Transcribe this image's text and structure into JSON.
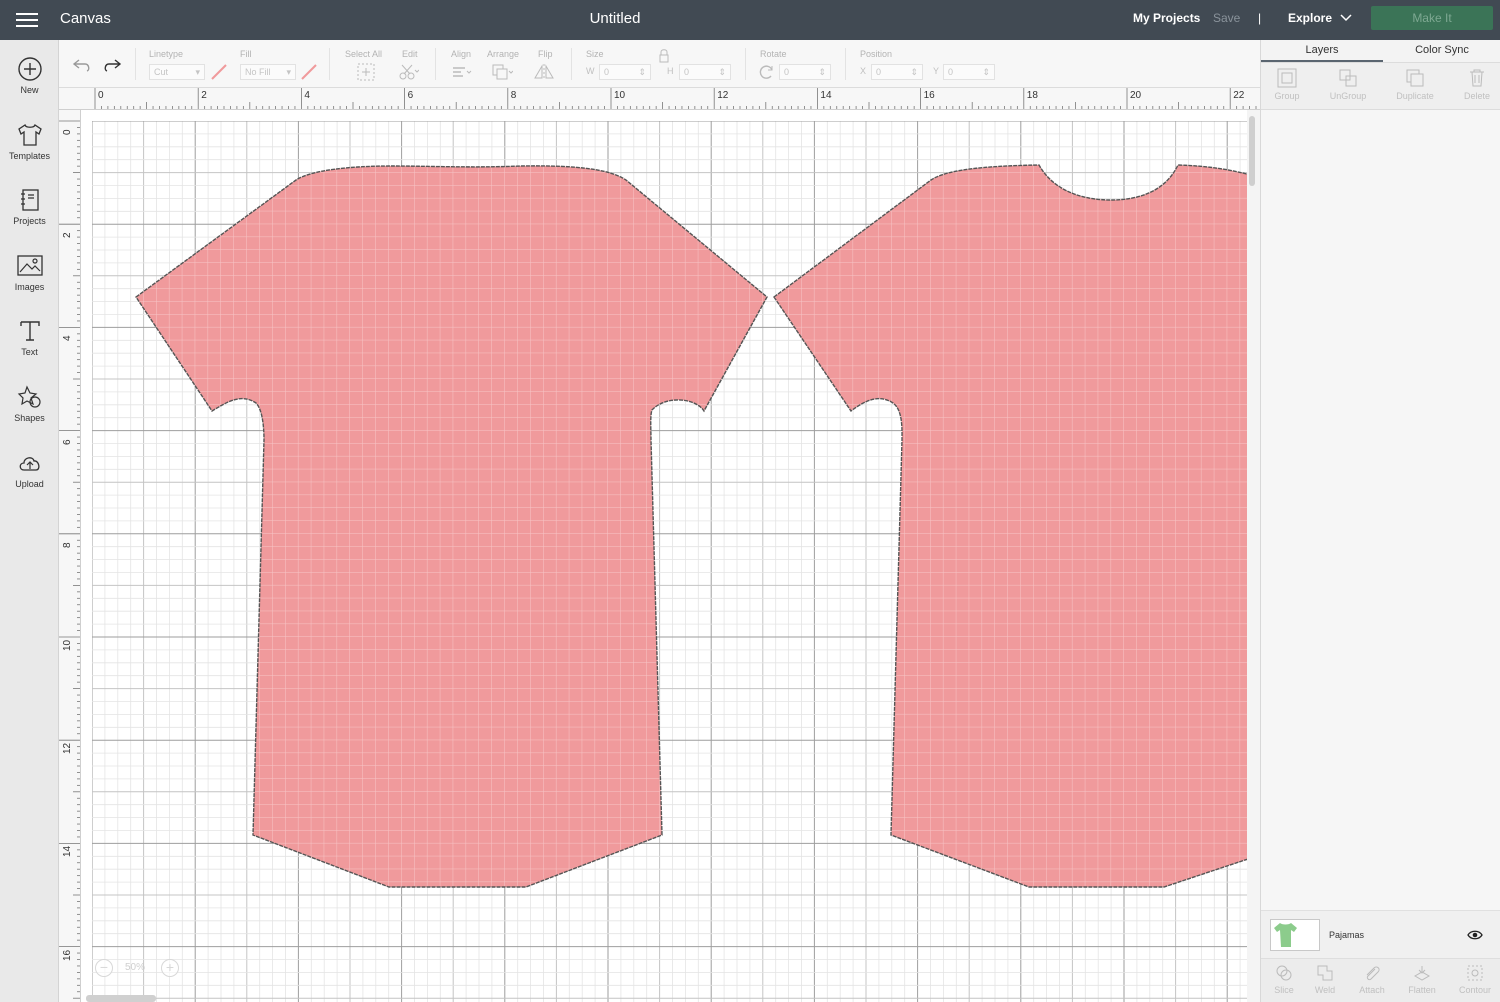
{
  "header": {
    "app_name": "Canvas",
    "doc_title": "Untitled",
    "my_projects": "My Projects",
    "save": "Save",
    "divider": "|",
    "explore": "Explore",
    "make_it": "Make It"
  },
  "sidebar": {
    "items": [
      {
        "label": "New",
        "icon": "plus-circle-icon"
      },
      {
        "label": "Templates",
        "icon": "tshirt-icon"
      },
      {
        "label": "Projects",
        "icon": "notebook-icon"
      },
      {
        "label": "Images",
        "icon": "image-icon"
      },
      {
        "label": "Text",
        "icon": "text-icon"
      },
      {
        "label": "Shapes",
        "icon": "shapes-icon"
      },
      {
        "label": "Upload",
        "icon": "cloud-upload-icon"
      }
    ]
  },
  "toolbar": {
    "linetype_label": "Linetype",
    "linetype_value": "Cut",
    "fill_label": "Fill",
    "fill_value": "No Fill",
    "select_all_label": "Select All",
    "edit_label": "Edit",
    "align_label": "Align",
    "arrange_label": "Arrange",
    "flip_label": "Flip",
    "size_label": "Size",
    "w_label": "W",
    "w_value": "0",
    "h_label": "H",
    "h_value": "0",
    "rotate_label": "Rotate",
    "rotate_value": "0",
    "position_label": "Position",
    "x_label": "X",
    "x_value": "0",
    "y_label": "Y",
    "y_value": "0"
  },
  "rulers": {
    "top": [
      "0",
      "2",
      "4",
      "6",
      "8",
      "10",
      "12",
      "14",
      "16",
      "18",
      "20",
      "22"
    ],
    "left": [
      "0",
      "2",
      "4",
      "6",
      "8",
      "10",
      "12",
      "14",
      "16"
    ]
  },
  "canvas": {
    "shape_color": "#f09a9c",
    "zoom_value": "50%",
    "zoom_minus": "−",
    "zoom_plus": "+"
  },
  "right_panel": {
    "tabs": [
      "Layers",
      "Color Sync"
    ],
    "tools": [
      "Group",
      "UnGroup",
      "Duplicate",
      "Delete"
    ],
    "layer_name": "Pajamas",
    "layer_thumb_color": "#8ccc8c",
    "bottom_tools": [
      "Slice",
      "Weld",
      "Attach",
      "Flatten",
      "Contour"
    ]
  }
}
